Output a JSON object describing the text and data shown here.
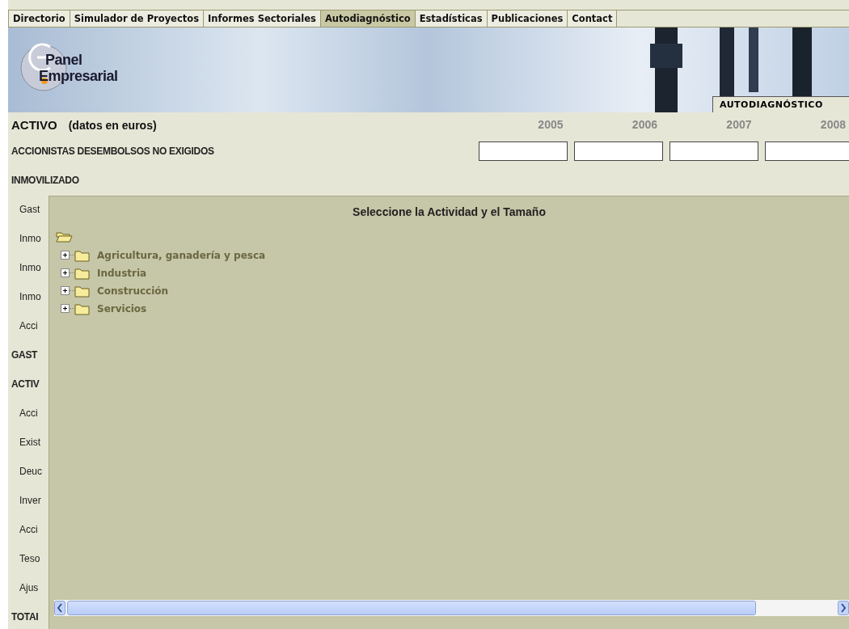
{
  "nav": {
    "tabs": [
      {
        "label": "Directorio",
        "selected": false
      },
      {
        "label": "Simulador de Proyectos",
        "selected": false
      },
      {
        "label": "Informes Sectoriales",
        "selected": false
      },
      {
        "label": "Autodiagnóstico",
        "selected": true
      },
      {
        "label": "Estadísticas",
        "selected": false
      },
      {
        "label": "Publicaciones",
        "selected": false
      },
      {
        "label": "Contact",
        "selected": false
      }
    ]
  },
  "banner": {
    "logo_lines": [
      "Panel",
      "Empresarial"
    ],
    "section_tag": "AUTODIAGNÓSTICO"
  },
  "table": {
    "title": "ACTIVO",
    "unit": "(datos en euros)",
    "columns": [
      "2005",
      "2006",
      "2007",
      "2008"
    ],
    "rows": [
      {
        "label": "ACCIONISTAS DESEMBOLSOS NO EXIGIDOS",
        "kind": "input_heading"
      },
      {
        "label": "INMOVILIZADO",
        "kind": "heading"
      },
      {
        "label": "Gast",
        "kind": "item"
      },
      {
        "label": "Inmo",
        "kind": "item"
      },
      {
        "label": "Inmo",
        "kind": "item"
      },
      {
        "label": "Inmo",
        "kind": "item"
      },
      {
        "label": "Acci",
        "kind": "item"
      },
      {
        "label": "GAST",
        "kind": "heading"
      },
      {
        "label": "ACTIV",
        "kind": "heading"
      },
      {
        "label": "Acci",
        "kind": "item"
      },
      {
        "label": "Exist",
        "kind": "item"
      },
      {
        "label": "Deuc",
        "kind": "item"
      },
      {
        "label": "Inver",
        "kind": "item"
      },
      {
        "label": "Acci",
        "kind": "item"
      },
      {
        "label": "Teso",
        "kind": "item"
      },
      {
        "label": "Ajus",
        "kind": "item"
      },
      {
        "label": "TOTAI",
        "kind": "heading"
      }
    ]
  },
  "dialog": {
    "title": "Seleccione la Actividad y el Tamaño",
    "tree": {
      "expanded": true,
      "children": [
        {
          "label": "Agricultura, ganadería y pesca",
          "expanded": false
        },
        {
          "label": "Industria",
          "expanded": false
        },
        {
          "label": "Construcción",
          "expanded": false
        },
        {
          "label": "Servicios",
          "expanded": false
        }
      ]
    }
  }
}
